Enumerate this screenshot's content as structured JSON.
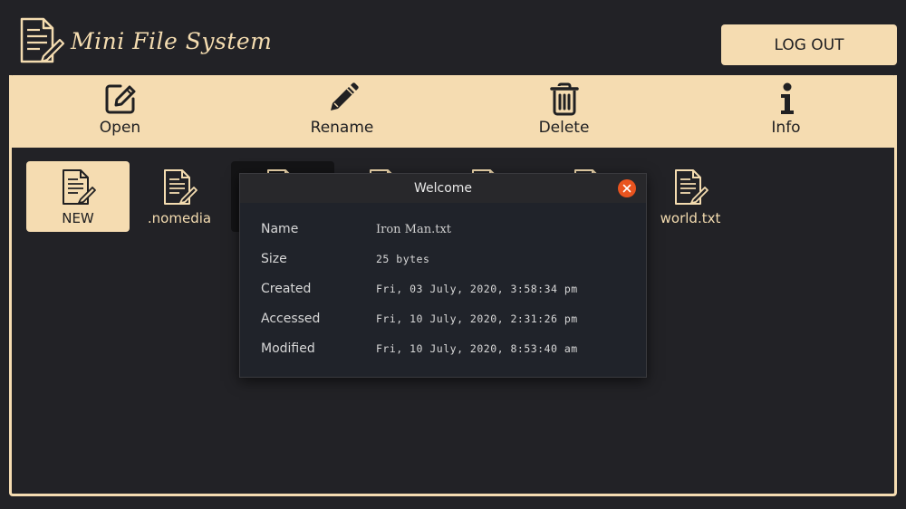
{
  "app": {
    "title": "Mini File System",
    "logout_label": "LOG OUT"
  },
  "toolbar": [
    {
      "label": "Open",
      "icon": "edit-icon"
    },
    {
      "label": "Rename",
      "icon": "pencil-icon"
    },
    {
      "label": "Delete",
      "icon": "trash-icon"
    },
    {
      "label": "Info",
      "icon": "info-icon"
    }
  ],
  "files": [
    {
      "label": "NEW",
      "state": "selected"
    },
    {
      "label": ".nomedia",
      "state": "normal"
    },
    {
      "label": "",
      "state": "highlighted"
    },
    {
      "label": "",
      "state": "normal"
    },
    {
      "label": "",
      "state": "normal"
    },
    {
      "label": "",
      "state": "normal"
    },
    {
      "label": "world.txt",
      "state": "normal"
    }
  ],
  "dialog": {
    "title": "Welcome",
    "rows": [
      {
        "label": "Name",
        "value": "Iron Man.txt"
      },
      {
        "label": "Size",
        "value": "25 bytes"
      },
      {
        "label": "Created",
        "value": "Fri, 03 July, 2020, 3:58:34 pm"
      },
      {
        "label": "Accessed",
        "value": "Fri, 10 July, 2020, 2:31:26 pm"
      },
      {
        "label": "Modified",
        "value": "Fri, 10 July, 2020, 8:53:40 am"
      }
    ]
  },
  "colors": {
    "accent": "#f5dcb1",
    "background": "#222226",
    "close": "#e9541f"
  }
}
